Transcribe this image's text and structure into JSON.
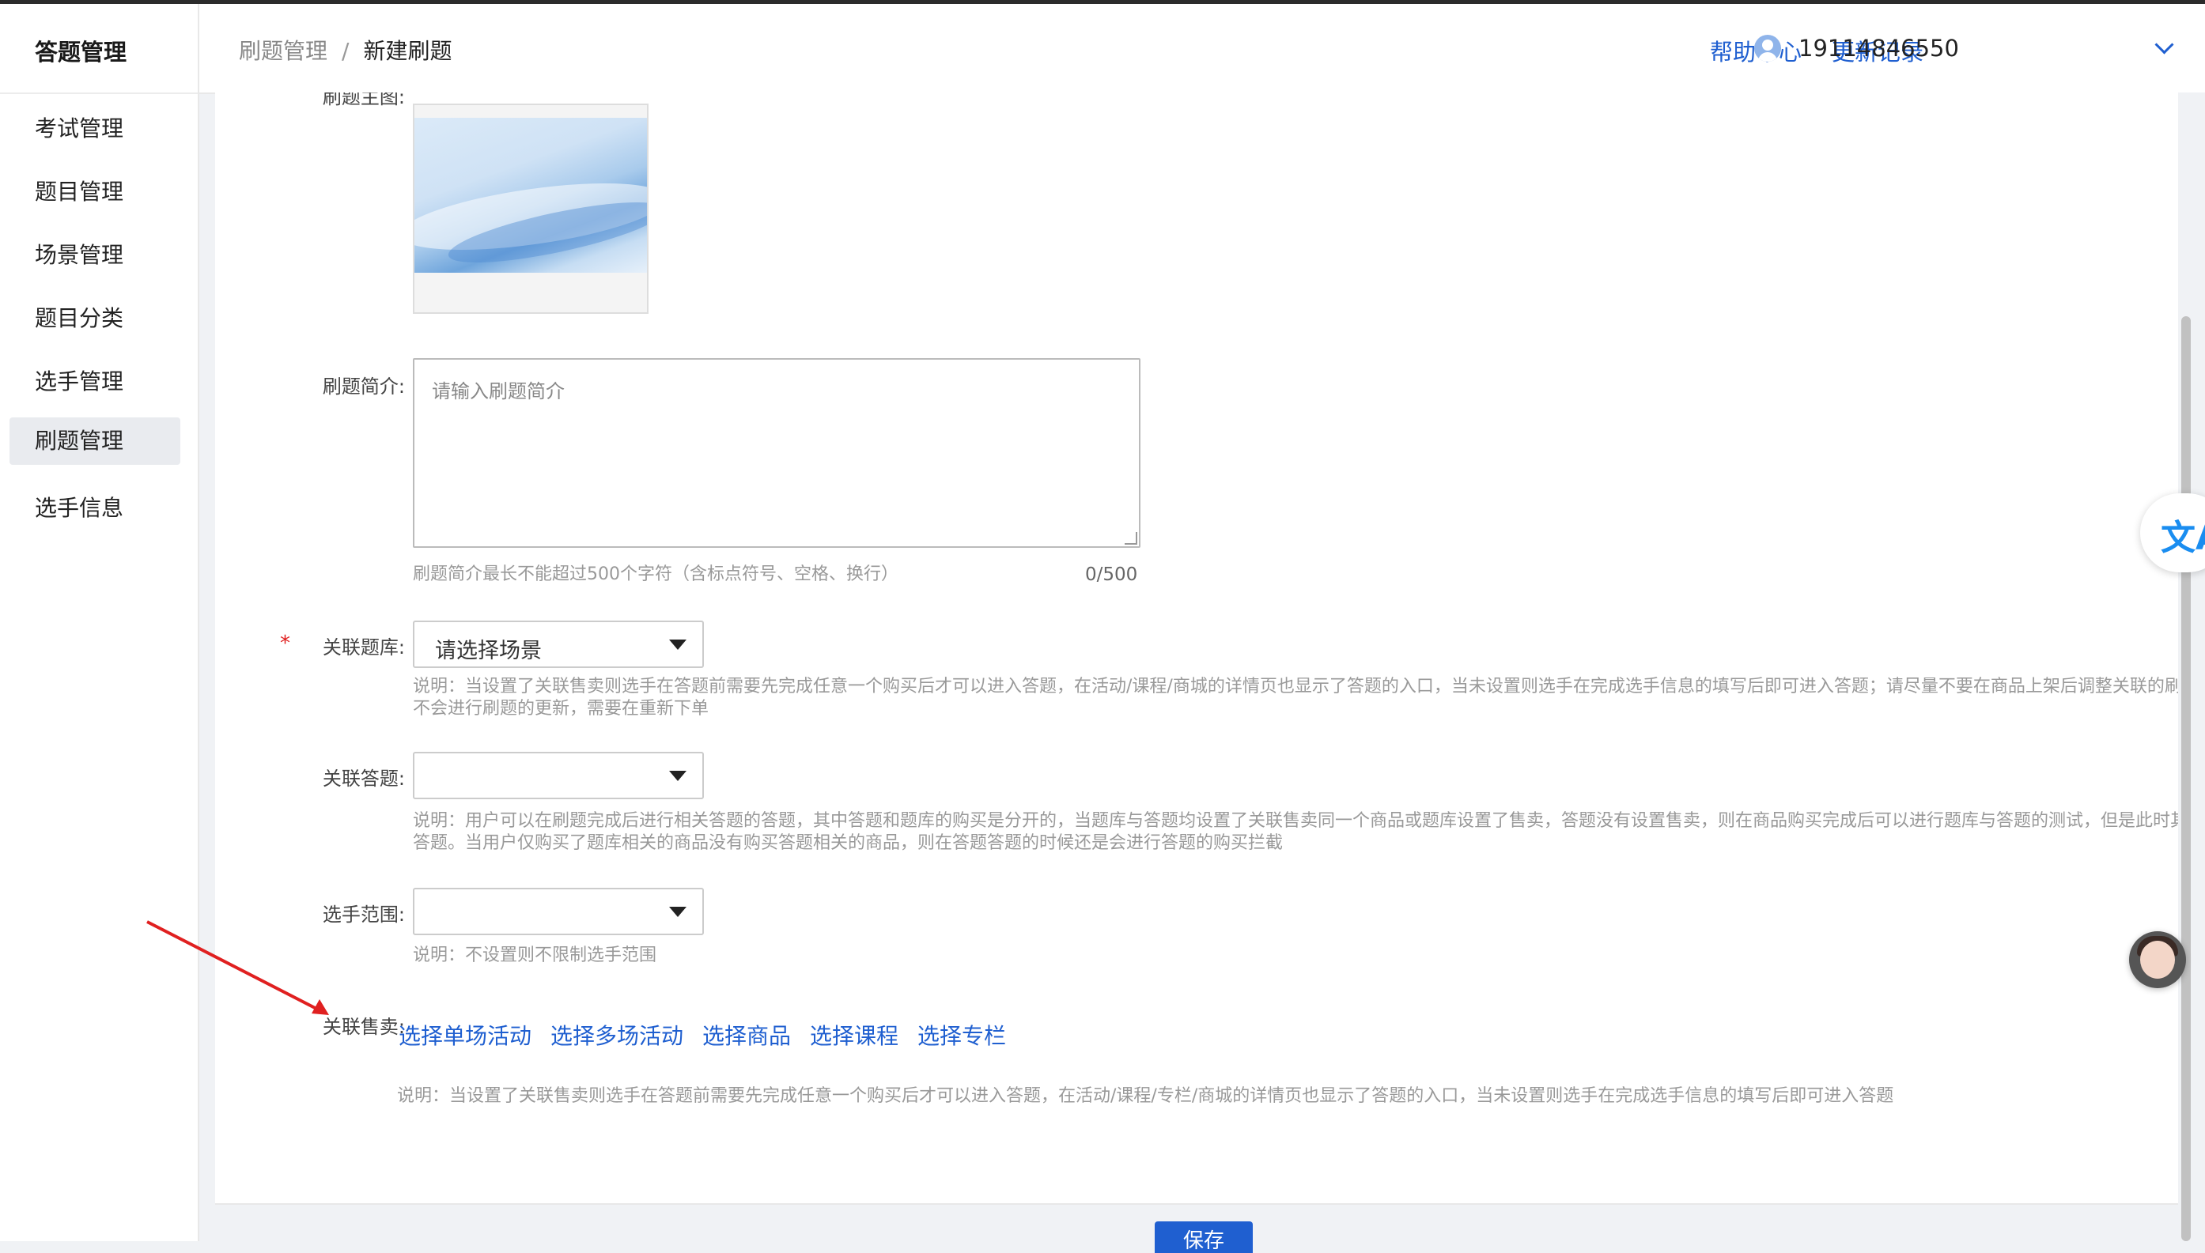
{
  "app": {
    "title": "答题管理"
  },
  "sidebar": {
    "items": [
      {
        "label": "考试管理",
        "active": false
      },
      {
        "label": "题目管理",
        "active": false
      },
      {
        "label": "场景管理",
        "active": false
      },
      {
        "label": "题目分类",
        "active": false
      },
      {
        "label": "选手管理",
        "active": false
      },
      {
        "label": "刷题管理",
        "active": true
      },
      {
        "label": "选手信息",
        "active": false
      }
    ]
  },
  "header": {
    "breadcrumb": {
      "parent": "刷题管理",
      "separator": "/",
      "current": "新建刷题"
    },
    "help_link": "帮助中心",
    "changelog_link": "更新记录",
    "user_phone": "19114846550"
  },
  "form": {
    "cover_label": "刷题主图:",
    "intro": {
      "label": "刷题简介:",
      "placeholder": "请输入刷题简介",
      "hint": "刷题简介最长不能超过500个字符（含标点符号、空格、换行）",
      "counter": "0/500"
    },
    "question_bank": {
      "label": "关联题库:",
      "required_mark": "*",
      "value": "请选择场景",
      "note": "说明：当设置了关联售卖则选手在答题前需要先完成任意一个购买后才可以进入答题，在活动/课程/商城的详情页也显示了答题的入口，当未设置则选手在完成选手信息的填写后即可进入答题；请尽量不要在商品上架后调整关联的刷题，调整后原来的客户不会进行刷题的更新，需要在重新下单"
    },
    "quiz": {
      "label": "关联答题:",
      "value": "",
      "note": "说明：用户可以在刷题完成后进行相关答题的答题，其中答题和题库的购买是分开的，当题库与答题均设置了关联售卖同一个商品或题库设置了售卖，答题没有设置售卖，则在商品购买完成后可以进行题库与答题的测试，但是此时其他用户也可以直接免费答题。当用户仅购买了题库相关的商品没有购买答题相关的商品，则在答题答题的时候还是会进行答题的购买拦截"
    },
    "player_scope": {
      "label": "选手范围:",
      "value": "",
      "note": "说明：不设置则不限制选手范围"
    },
    "sales": {
      "label": "关联售卖:",
      "links": [
        "选择单场活动",
        "选择多场活动",
        "选择商品",
        "选择课程",
        "选择专栏"
      ],
      "note": "说明：当设置了关联售卖则选手在答题前需要先完成任意一个购买后才可以进入答题，在活动/课程/专栏/商城的详情页也显示了答题的入口，当未设置则选手在完成选手信息的填写后即可进入答题"
    },
    "save_button": "保存"
  },
  "icons": {
    "translate": "translate-icon",
    "assistant": "assistant-avatar-icon",
    "user": "user-avatar-icon",
    "dropdown": "chevron-down-icon"
  },
  "colors": {
    "link": "#1f5fd0",
    "required": "#e02020",
    "annotation_arrow": "#e02020"
  }
}
